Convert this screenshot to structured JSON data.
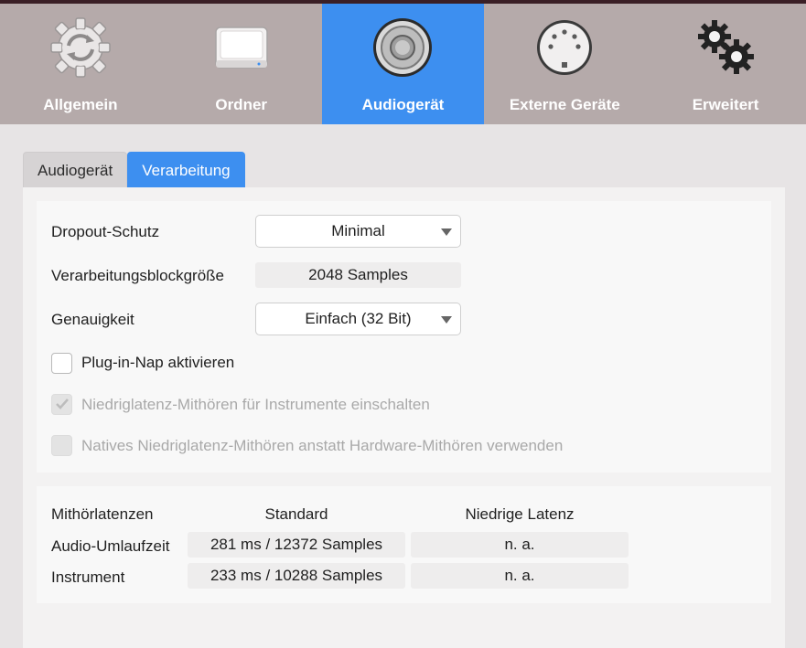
{
  "toolbar": {
    "items": [
      {
        "label": "Allgemein",
        "icon": "sync-gear-icon",
        "active": false
      },
      {
        "label": "Ordner",
        "icon": "drive-icon",
        "active": false
      },
      {
        "label": "Audiogerät",
        "icon": "speaker-icon",
        "active": true
      },
      {
        "label": "Externe Geräte",
        "icon": "midi-connector-icon",
        "active": false
      },
      {
        "label": "Erweitert",
        "icon": "gears-icon",
        "active": false
      }
    ],
    "accent": "#3d8ff0"
  },
  "tabs": [
    {
      "label": "Audiogerät",
      "active": false
    },
    {
      "label": "Verarbeitung",
      "active": true
    }
  ],
  "processing": {
    "dropout_label": "Dropout-Schutz",
    "dropout_value": "Minimal",
    "blocksize_label": "Verarbeitungsblockgröße",
    "blocksize_value": "2048 Samples",
    "precision_label": "Genauigkeit",
    "precision_value": "Einfach (32 Bit)",
    "checkboxes": [
      {
        "label": "Plug-in-Nap aktivieren",
        "checked": false,
        "enabled": true
      },
      {
        "label": "Niedriglatenz-Mithören für Instrumente einschalten",
        "checked": true,
        "enabled": false
      },
      {
        "label": "Natives Niedriglatenz-Mithören anstatt Hardware-Mithören verwenden",
        "checked": false,
        "enabled": false
      }
    ]
  },
  "latency": {
    "header": "Mithörlatenzen",
    "col_standard": "Standard",
    "col_low": "Niedrige Latenz",
    "rows": [
      {
        "label": "Audio-Umlaufzeit",
        "standard": "281 ms / 12372 Samples",
        "low": "n. a."
      },
      {
        "label": "Instrument",
        "standard": "233 ms / 10288 Samples",
        "low": "n. a."
      }
    ]
  }
}
